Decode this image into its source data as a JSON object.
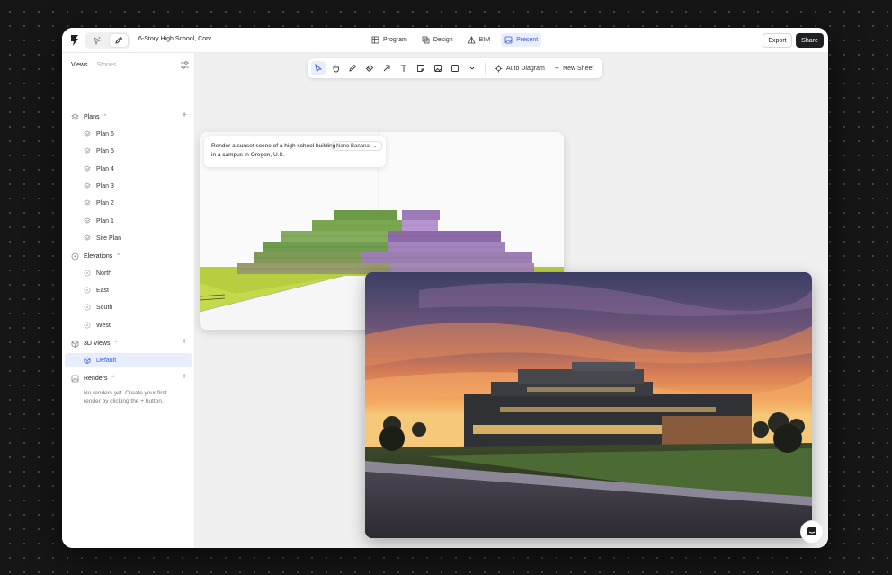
{
  "app": {
    "project_title": "6-Story High School, Corv...",
    "nav": [
      {
        "label": "Program",
        "icon": "table-icon"
      },
      {
        "label": "Design",
        "icon": "shapes-icon"
      },
      {
        "label": "BIM",
        "icon": "structure-icon"
      },
      {
        "label": "Present",
        "icon": "image-icon",
        "active": true
      }
    ],
    "export_label": "Export",
    "share_label": "Share",
    "accent_color": "#3b5bdb"
  },
  "sidebar": {
    "tabs": [
      {
        "label": "Views",
        "active": true
      },
      {
        "label": "Stories",
        "active": false
      }
    ],
    "sections": {
      "plans": {
        "label": "Plans",
        "items": [
          "Plan 6",
          "Plan 5",
          "Plan 4",
          "Plan 3",
          "Plan 2",
          "Plan 1",
          "Site Plan"
        ]
      },
      "elevations": {
        "label": "Elevations",
        "items": [
          "North",
          "East",
          "South",
          "West"
        ]
      },
      "views3d": {
        "label": "3D Views",
        "items": [
          "Default"
        ],
        "selected": "Default"
      },
      "renders": {
        "label": "Renders",
        "empty_note": "No renders yet. Create your first render by clicking the + button."
      }
    }
  },
  "toolbar": {
    "tools": [
      "select-icon",
      "hand-icon",
      "pen-icon",
      "eraser-icon",
      "arrow-icon",
      "text-icon",
      "sticky-note-icon",
      "image-icon",
      "rectangle-icon",
      "chevron-down-icon"
    ],
    "auto_diagram_label": "Auto Diagram",
    "new_sheet_label": "New Sheet"
  },
  "prompt": {
    "text": "Render a sunset scene of a high school building in a campus in Oregon, U.S.",
    "model": "Nano Banana"
  }
}
